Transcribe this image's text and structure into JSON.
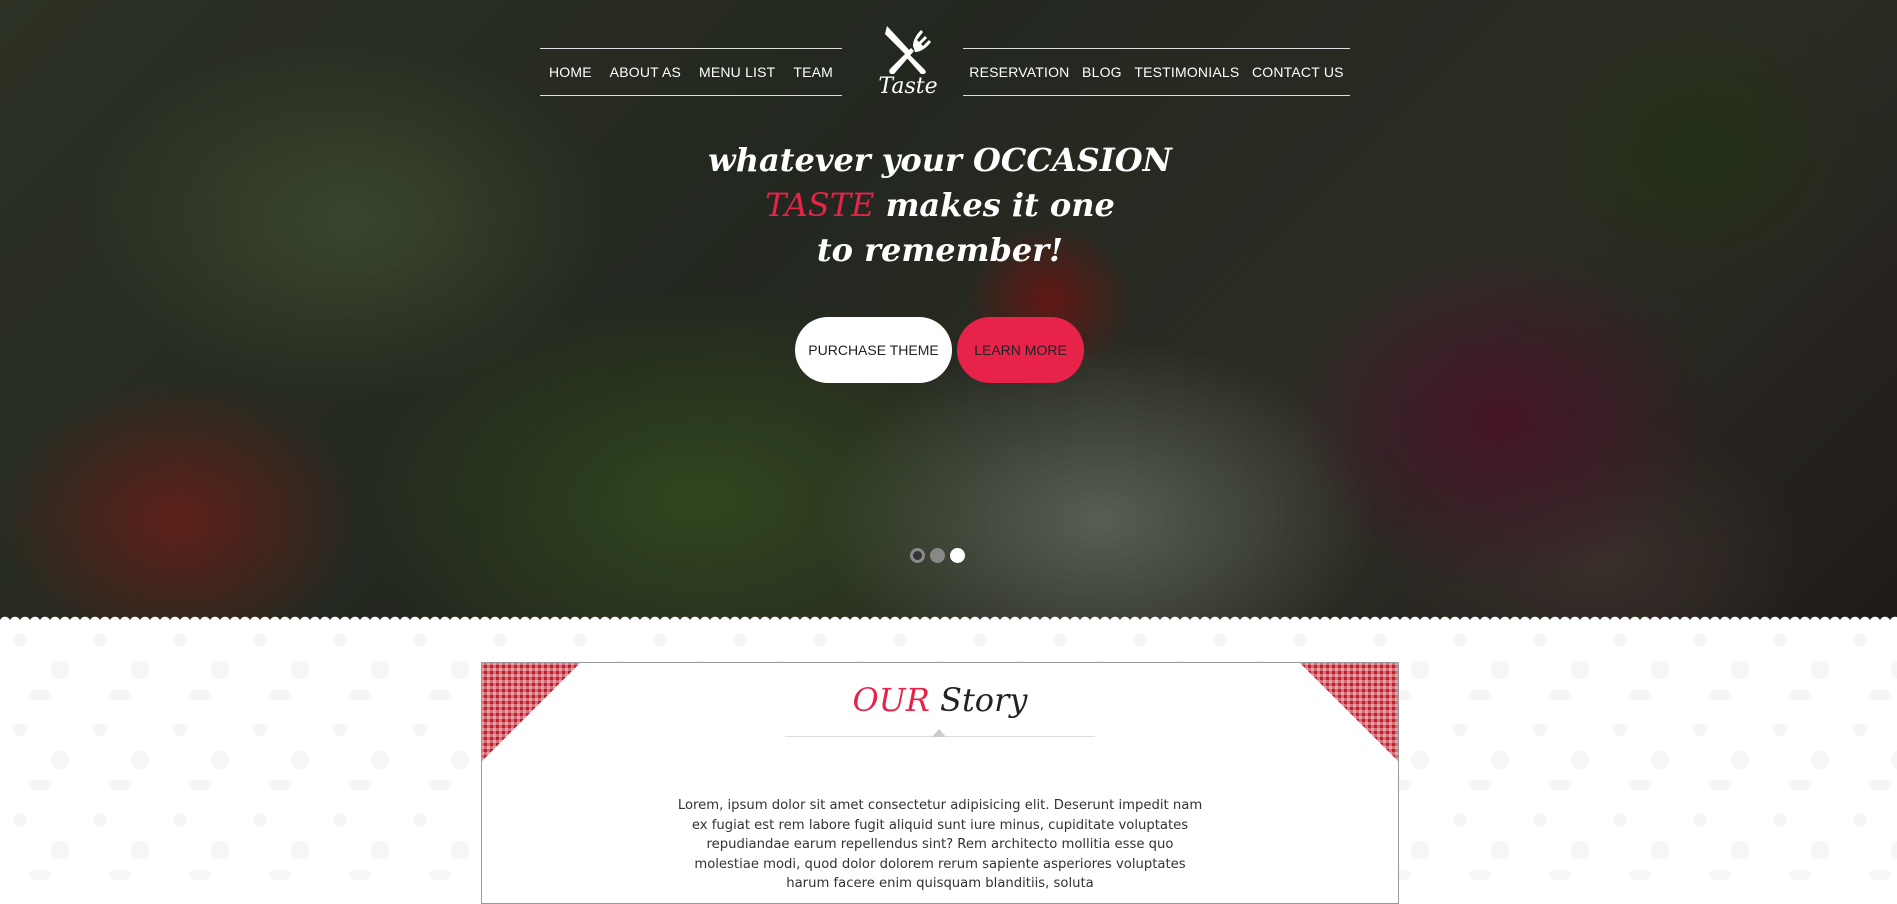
{
  "nav": {
    "left": [
      "HOME",
      "ABOUT AS",
      "MENU LIST",
      "TEAM"
    ],
    "right": [
      "RESERVATION",
      "BLOG",
      "TESTIMONIALS",
      "CONTACT US"
    ]
  },
  "logo": {
    "text": "Taste",
    "icon": "fork-knife-icon"
  },
  "hero": {
    "line1": "whatever your OCCASION",
    "line2_accent": "TASTE",
    "line2_rest": " makes it one",
    "line3": "to remember!",
    "buttons": {
      "purchase": "PURCHASE THEME",
      "learn": "LEARN MORE"
    },
    "slides": {
      "count": 3,
      "active": 3
    }
  },
  "story": {
    "title_accent": "OUR",
    "title_rest": " Story",
    "text": "Lorem, ipsum dolor sit amet consectetur adipisicing elit. Deserunt impedit nam ex fugiat est rem labore fugit aliquid sunt iure minus, cupiditate voluptates repudiandae earum repellendus sint? Rem architecto mollitia esse quo molestiae modi, quod dolor dolorem rerum sapiente asperiores voluptates harum facere enim quisquam blanditiis, soluta"
  },
  "colors": {
    "accent": "#e8234a",
    "corner_pattern": "#c0202e"
  }
}
